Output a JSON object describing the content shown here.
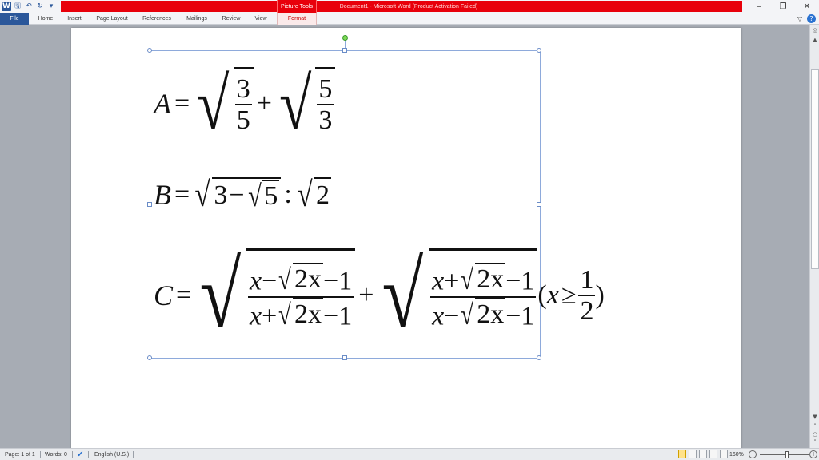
{
  "title_bar": {
    "quick_access": [
      "word-app-icon",
      "save-icon",
      "undo-icon",
      "redo-icon",
      "customize-icon"
    ],
    "contextual_group": "Picture Tools",
    "document_title": "Document1 - Microsoft Word (Product Activation Failed)",
    "window_controls": {
      "minimize": "–",
      "restore": "❐",
      "close": "✕"
    }
  },
  "ribbon": {
    "tabs": [
      "File",
      "Home",
      "Insert",
      "Page Layout",
      "References",
      "Mailings",
      "Review",
      "View",
      "Format"
    ],
    "active_tab": "File",
    "contextual_tab": "Format"
  },
  "equations": {
    "A": {
      "lhs": "A",
      "eq": "=",
      "frac1": {
        "num": "3",
        "den": "5"
      },
      "plus": "+",
      "frac2": {
        "num": "5",
        "den": "3"
      }
    },
    "B": {
      "lhs": "B",
      "eq": "=",
      "outer_a": "3",
      "minus": "−",
      "inner": "5",
      "colon": ":",
      "sqrt2": "2"
    },
    "C": {
      "lhs": "C",
      "eq": "=",
      "f1_num_a": "x",
      "f1_num_op": "−",
      "f1_num_rad": "2x",
      "f1_num_tail": "−1",
      "f1_den_a": "x",
      "f1_den_op": "+",
      "f1_den_rad": "2x",
      "f1_den_tail": "−1",
      "plus": "+",
      "f2_num_a": "x",
      "f2_num_op": "+",
      "f2_num_rad": "2x",
      "f2_num_tail": "−1",
      "f2_den_a": "x",
      "f2_den_op": "−",
      "f2_den_rad": "2x",
      "f2_den_tail": "−1",
      "cond_open": "(",
      "cond_x": "x",
      "cond_ge": "≥",
      "cond_num": "1",
      "cond_den": "2",
      "cond_close": ")"
    }
  },
  "status_bar": {
    "page": "Page: 1 of 1",
    "words": "Words: 0",
    "language": "English (U.S.)",
    "zoom": "160%",
    "zoom_level_percent": 160
  }
}
